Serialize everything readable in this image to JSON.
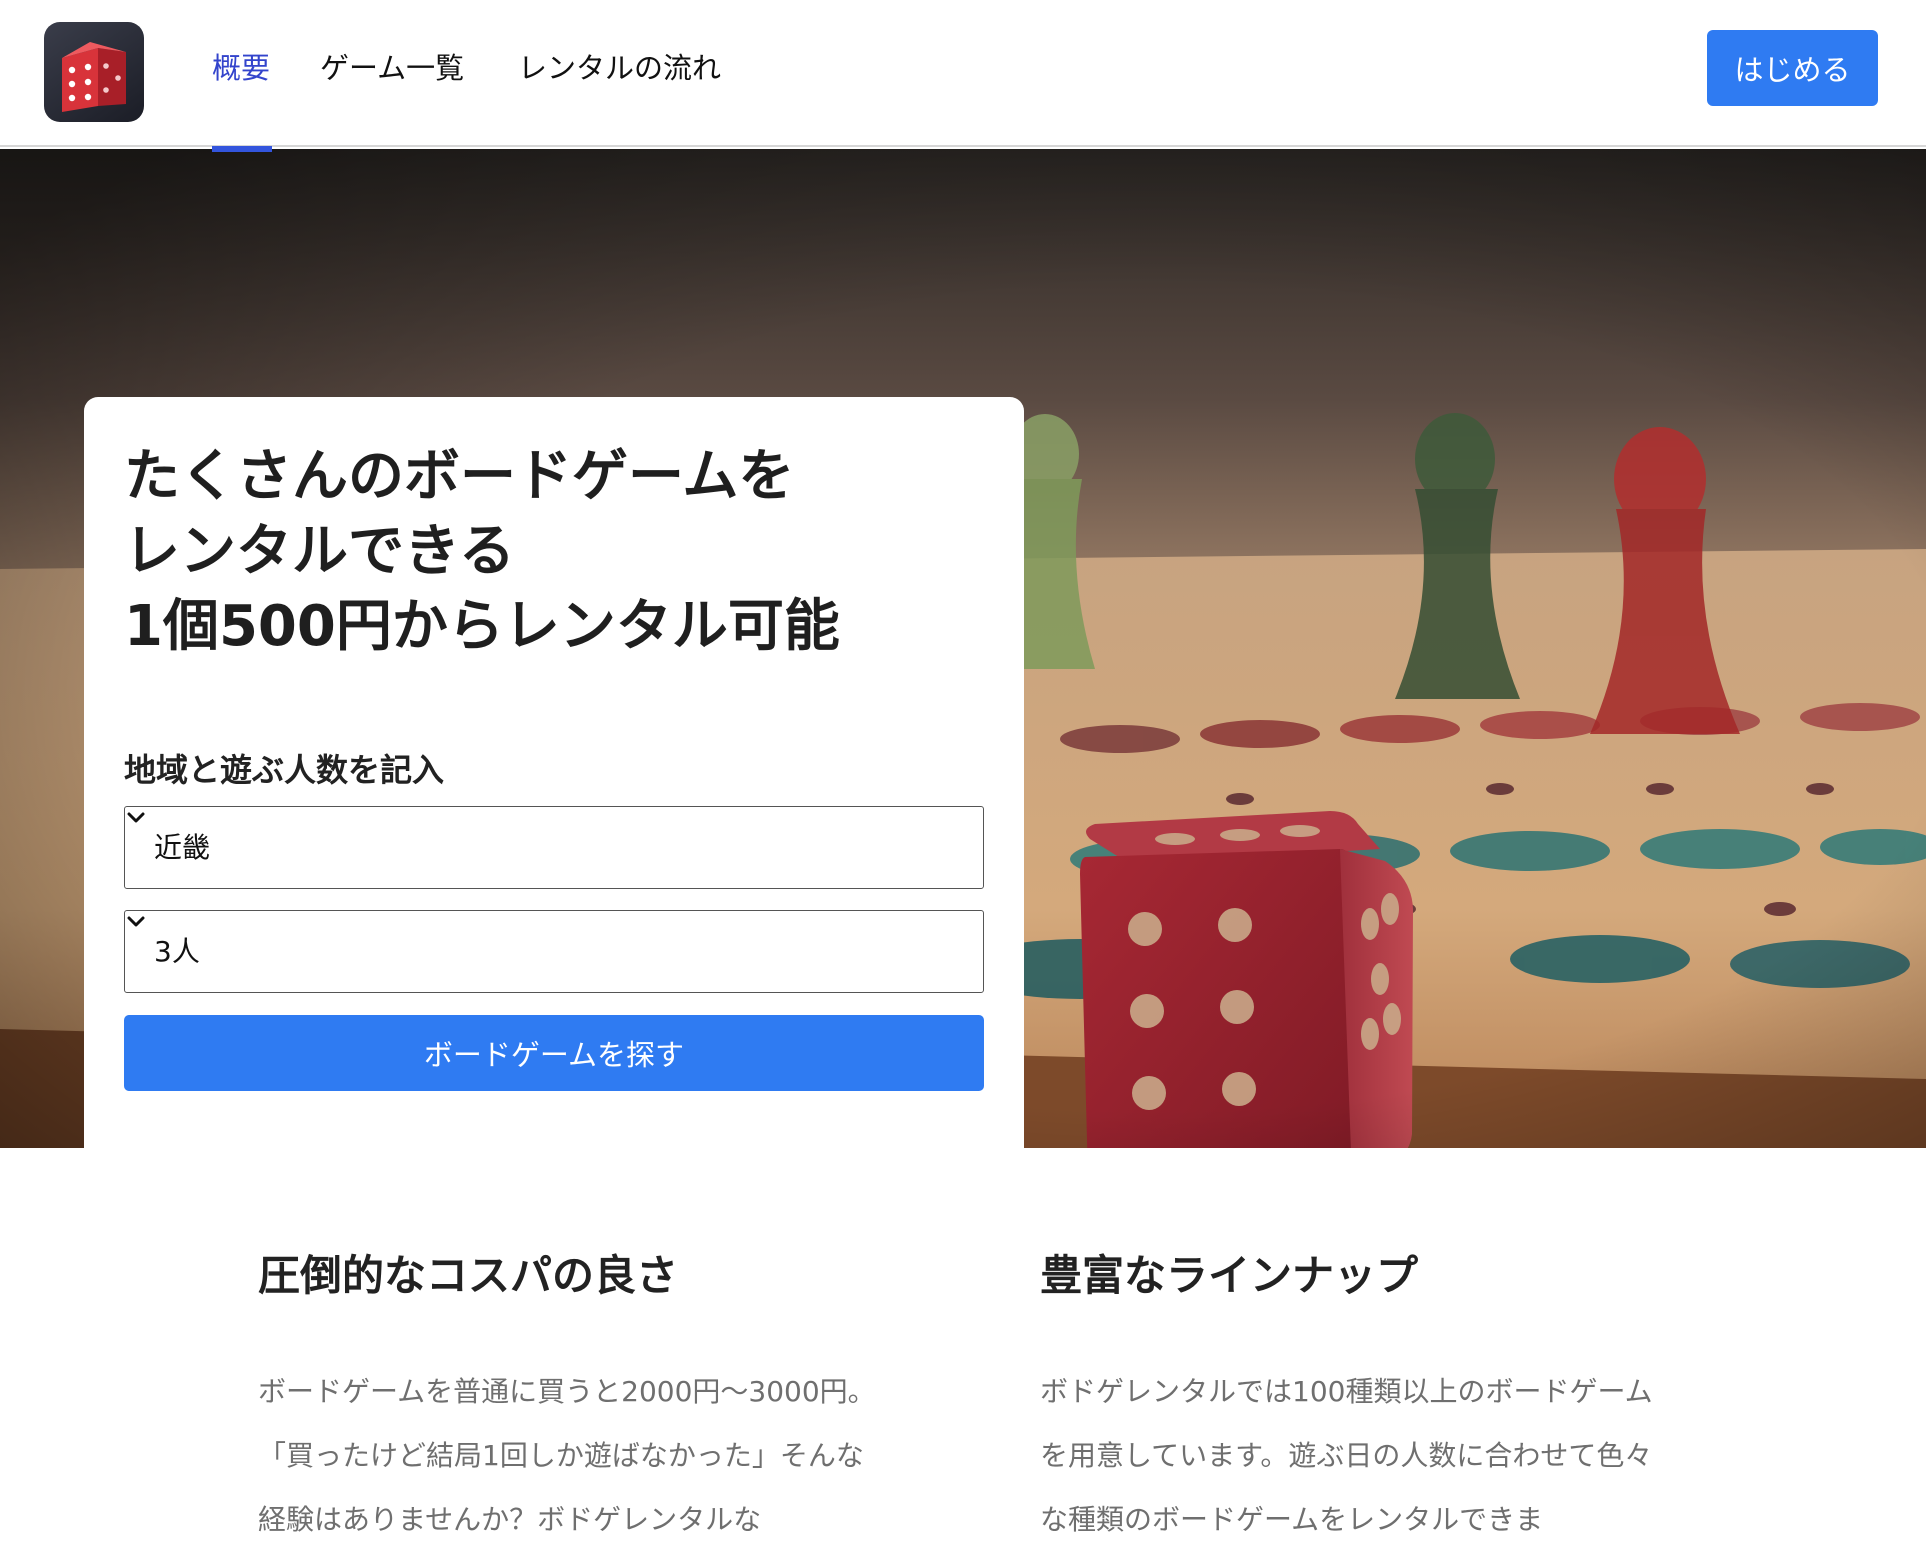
{
  "header": {
    "logo_icon": "red-dice-icon",
    "nav": [
      {
        "label": "概要",
        "active": true
      },
      {
        "label": "ゲーム一覧",
        "active": false
      },
      {
        "label": "レンタルの流れ",
        "active": false
      }
    ],
    "start_button": "はじめる"
  },
  "hero": {
    "background_image": "board-game-with-red-dice-photo",
    "title_lines": [
      "たくさんのボードゲームを",
      "レンタルできる",
      "1個500円からレンタル可能"
    ],
    "form": {
      "label": "地域と遊ぶ人数を記入",
      "region_select": {
        "value": "近畿"
      },
      "people_select": {
        "value": "3人"
      },
      "search_button": "ボードゲームを探す"
    }
  },
  "features": [
    {
      "title": "圧倒的なコスパの良さ",
      "text": "ボードゲームを普通に買うと2000円〜3000円。「買ったけど結局1回しか遊ばなかった」そんな経験はありませんか？ボドゲレンタルな"
    },
    {
      "title": "豊富なラインナップ",
      "text": "ボドゲレンタルでは100種類以上のボードゲームを用意しています。遊ぶ日の人数に合わせて色々な種類のボードゲームをレンタルできま"
    }
  ],
  "colors": {
    "accent": "#2f7bf2",
    "nav_active": "#3344cc",
    "dice_red": "#b52a35"
  }
}
